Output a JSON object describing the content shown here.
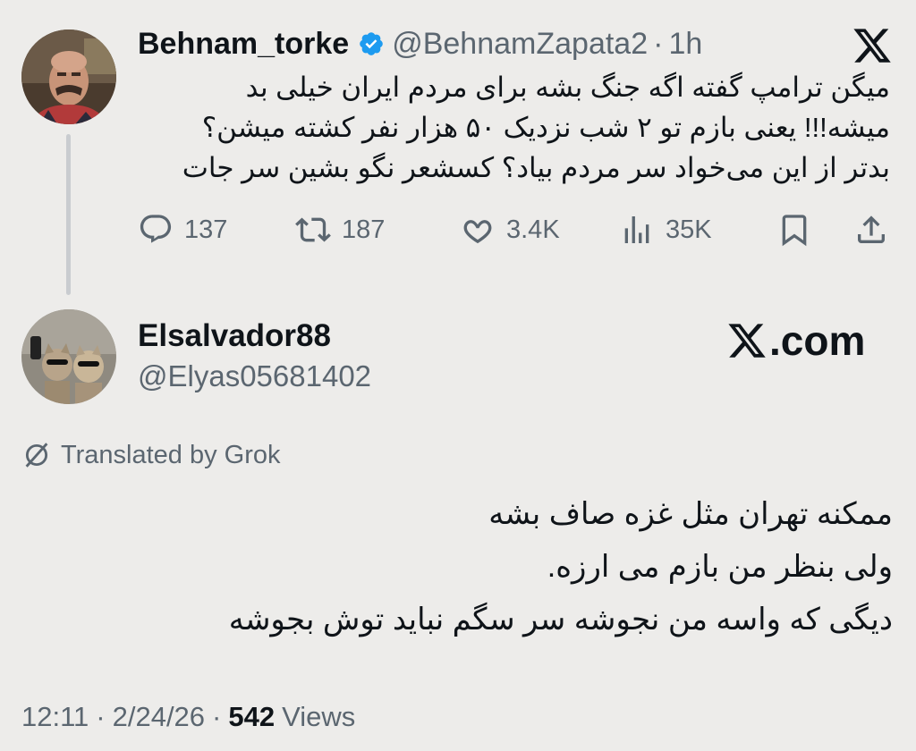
{
  "parent_tweet": {
    "display_name": "Behnam_torke",
    "handle": "@BehnamZapata2",
    "separator": "·",
    "time": "1h",
    "text_lines": [
      "میگن ترامپ گفته اگه جنگ بشه برای مردم ایران خیلی بد",
      "میشه!!! یعنی بازم تو ۲ شب نزدیک ۵۰ هزار نفر کشته میشن؟",
      "بدتر از این می‌خواد سر مردم بیاد؟ کسشعر نگو بشین سر جات"
    ],
    "actions": {
      "replies": "137",
      "reposts": "187",
      "likes": "3.4K",
      "views": "35K"
    }
  },
  "reply_tweet": {
    "display_name": "Elsalvador88",
    "handle": "@Elyas05681402",
    "brand": ".com",
    "translated_label": "Translated by Grok",
    "text_lines": [
      "ممکنه تهران مثل غزه صاف بشه",
      "ولی بنظر من بازم می ارزه.",
      "دیگی که واسه من نجوشه سر سگم نباید توش بجوشه"
    ],
    "meta": {
      "time": "12:11",
      "date": "2/24/26",
      "sep": "·",
      "views_count": "542",
      "views_label": "Views"
    }
  },
  "icons": {
    "verified": "verified-badge-icon",
    "x_logo": "x-logo-icon",
    "reply": "reply-icon",
    "repost": "repost-icon",
    "like": "heart-icon",
    "views": "views-icon",
    "bookmark": "bookmark-icon",
    "share": "share-icon",
    "translate": "translate-slash-icon"
  },
  "colors": {
    "background": "#edecea",
    "text": "#0f1419",
    "muted": "#5b6670",
    "verified": "#1d9bf0"
  }
}
